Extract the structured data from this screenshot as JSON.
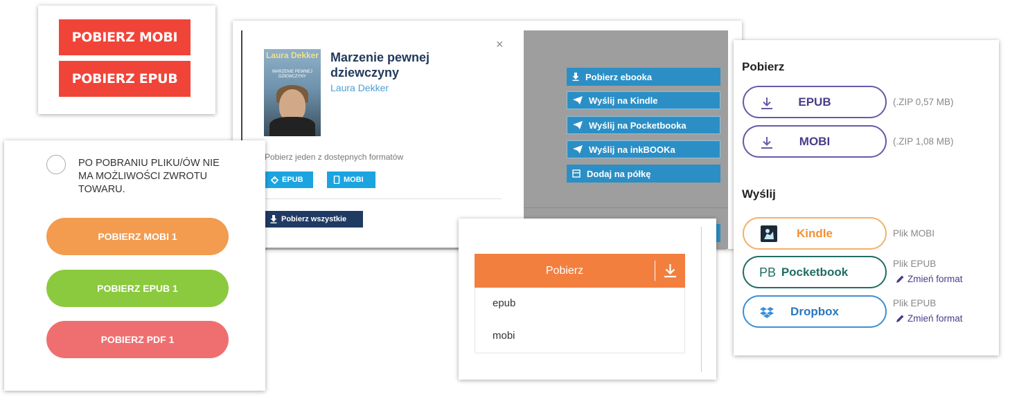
{
  "panel_a": {
    "mobi_label": "POBIERZ MOBI",
    "epub_label": "POBIERZ EPUB",
    "accent": "#f04438"
  },
  "panel_b": {
    "close": "×",
    "book": {
      "title": "Marzenie pewnej dziewczyny",
      "author": "Laura Dekker"
    },
    "cover": {
      "author_text": "Laura Dekker",
      "title_text": "MARZENIE PEWNEJ DZIEWCZYNY"
    },
    "formats_hint": "Pobierz jeden z dostępnych formatów",
    "formats": [
      {
        "label": "EPUB",
        "icon": "tag-icon"
      },
      {
        "label": "MOBI",
        "icon": "phone-icon"
      }
    ],
    "download_all": "Pobierz wszystkie",
    "side_actions": [
      {
        "label": "Pobierz ebooka",
        "icon": "download-icon"
      },
      {
        "label": "Wyślij na Kindle",
        "icon": "paper-plane-icon"
      },
      {
        "label": "Wyślij na Pocketbooka",
        "icon": "paper-plane-icon"
      },
      {
        "label": "Wyślij na inkBOOKa",
        "icon": "paper-plane-icon"
      },
      {
        "label": "Dodaj na półkę",
        "icon": "shelf-icon"
      }
    ]
  },
  "panel_c": {
    "notice": "PO POBRANIU PLIKU/ÓW NIE MA MOŻLIWOŚCI ZWROTU TOWARU.",
    "buttons": [
      {
        "label": "POBIERZ MOBI 1",
        "color": "#f39b4e"
      },
      {
        "label": "POBIERZ EPUB 1",
        "color": "#8bc93e"
      },
      {
        "label": "POBIERZ PDF 1",
        "color": "#ef6f70"
      }
    ]
  },
  "panel_d": {
    "button": "Pobierz",
    "options": [
      "epub",
      "mobi"
    ],
    "accent": "#f37f3f"
  },
  "panel_e": {
    "download_heading": "Pobierz",
    "send_heading": "Wyślij",
    "downloads": [
      {
        "label": "EPUB",
        "size": "(.ZIP 0,57 MB)"
      },
      {
        "label": "MOBI",
        "size": "(.ZIP 1,08 MB)"
      }
    ],
    "send": [
      {
        "label": "Kindle",
        "type": "Plik MOBI",
        "change": ""
      },
      {
        "label": "Pocketbook",
        "icon_text": "PB",
        "type": "Plik EPUB",
        "change": "Zmień format"
      },
      {
        "label": "Dropbox",
        "type": "Plik EPUB",
        "change": "Zmień format"
      }
    ]
  }
}
